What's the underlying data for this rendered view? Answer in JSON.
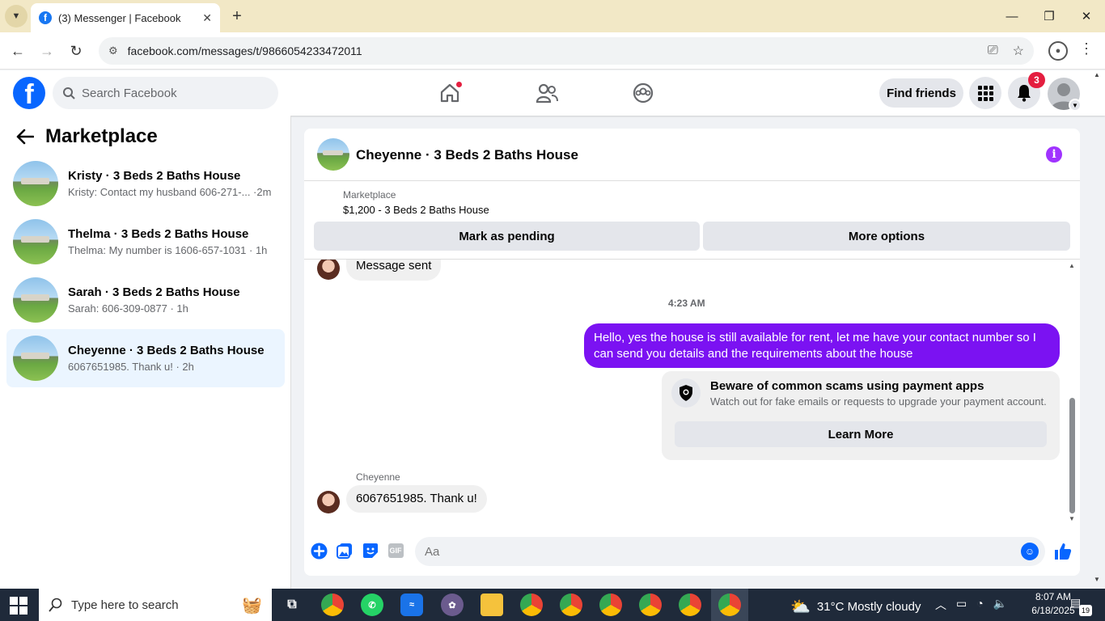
{
  "browser": {
    "tab_title": "(3) Messenger | Facebook",
    "url": "facebook.com/messages/t/9866054233472011"
  },
  "fb": {
    "search_placeholder": "Search Facebook",
    "find_friends": "Find friends",
    "notifications_count": "3"
  },
  "sidebar": {
    "title": "Marketplace",
    "conversations": [
      {
        "name": "Kristy · 3 Beds 2 Baths House",
        "preview": "Kristy: Contact my husband 606-271-... ·2m"
      },
      {
        "name": "Thelma · 3 Beds 2 Baths House",
        "preview": "Thelma: My number is 1606-657-1031 · 1h"
      },
      {
        "name": "Sarah · 3 Beds 2 Baths House",
        "preview": "Sarah: 606-309-0877 · 1h"
      },
      {
        "name": "Cheyenne · 3 Beds 2 Baths House",
        "preview": "6067651985. Thank u! · 2h"
      }
    ]
  },
  "chat": {
    "title": "Cheyenne · 3 Beds 2 Baths House",
    "marketplace_label": "Marketplace",
    "listing": "$1,200 - 3 Beds 2 Baths House",
    "mark_pending": "Mark as pending",
    "more_options": "More options",
    "prev_message": "Message sent",
    "timestamp": "4:23 AM",
    "outgoing_message": "Hello, yes the house is still available for rent, let me have your contact number so I can send you details and the requirements about the house",
    "scam_title": "Beware of common scams using payment apps",
    "scam_subtitle": "Watch out for fake emails or requests to upgrade your payment account.",
    "learn_more": "Learn More",
    "sender": "Cheyenne",
    "incoming_message": "6067651985. Thank u!",
    "composer_placeholder": "Aa",
    "gif_label": "GIF"
  },
  "taskbar": {
    "search_placeholder": "Type here to search",
    "weather": "31°C  Mostly cloudy",
    "time": "8:07 AM",
    "date": "6/18/2025",
    "notification_count": "19"
  },
  "colors": {
    "fb_blue": "#0866ff",
    "outgoing_bubble": "#7b12f2",
    "badge_red": "#e41e3f"
  }
}
